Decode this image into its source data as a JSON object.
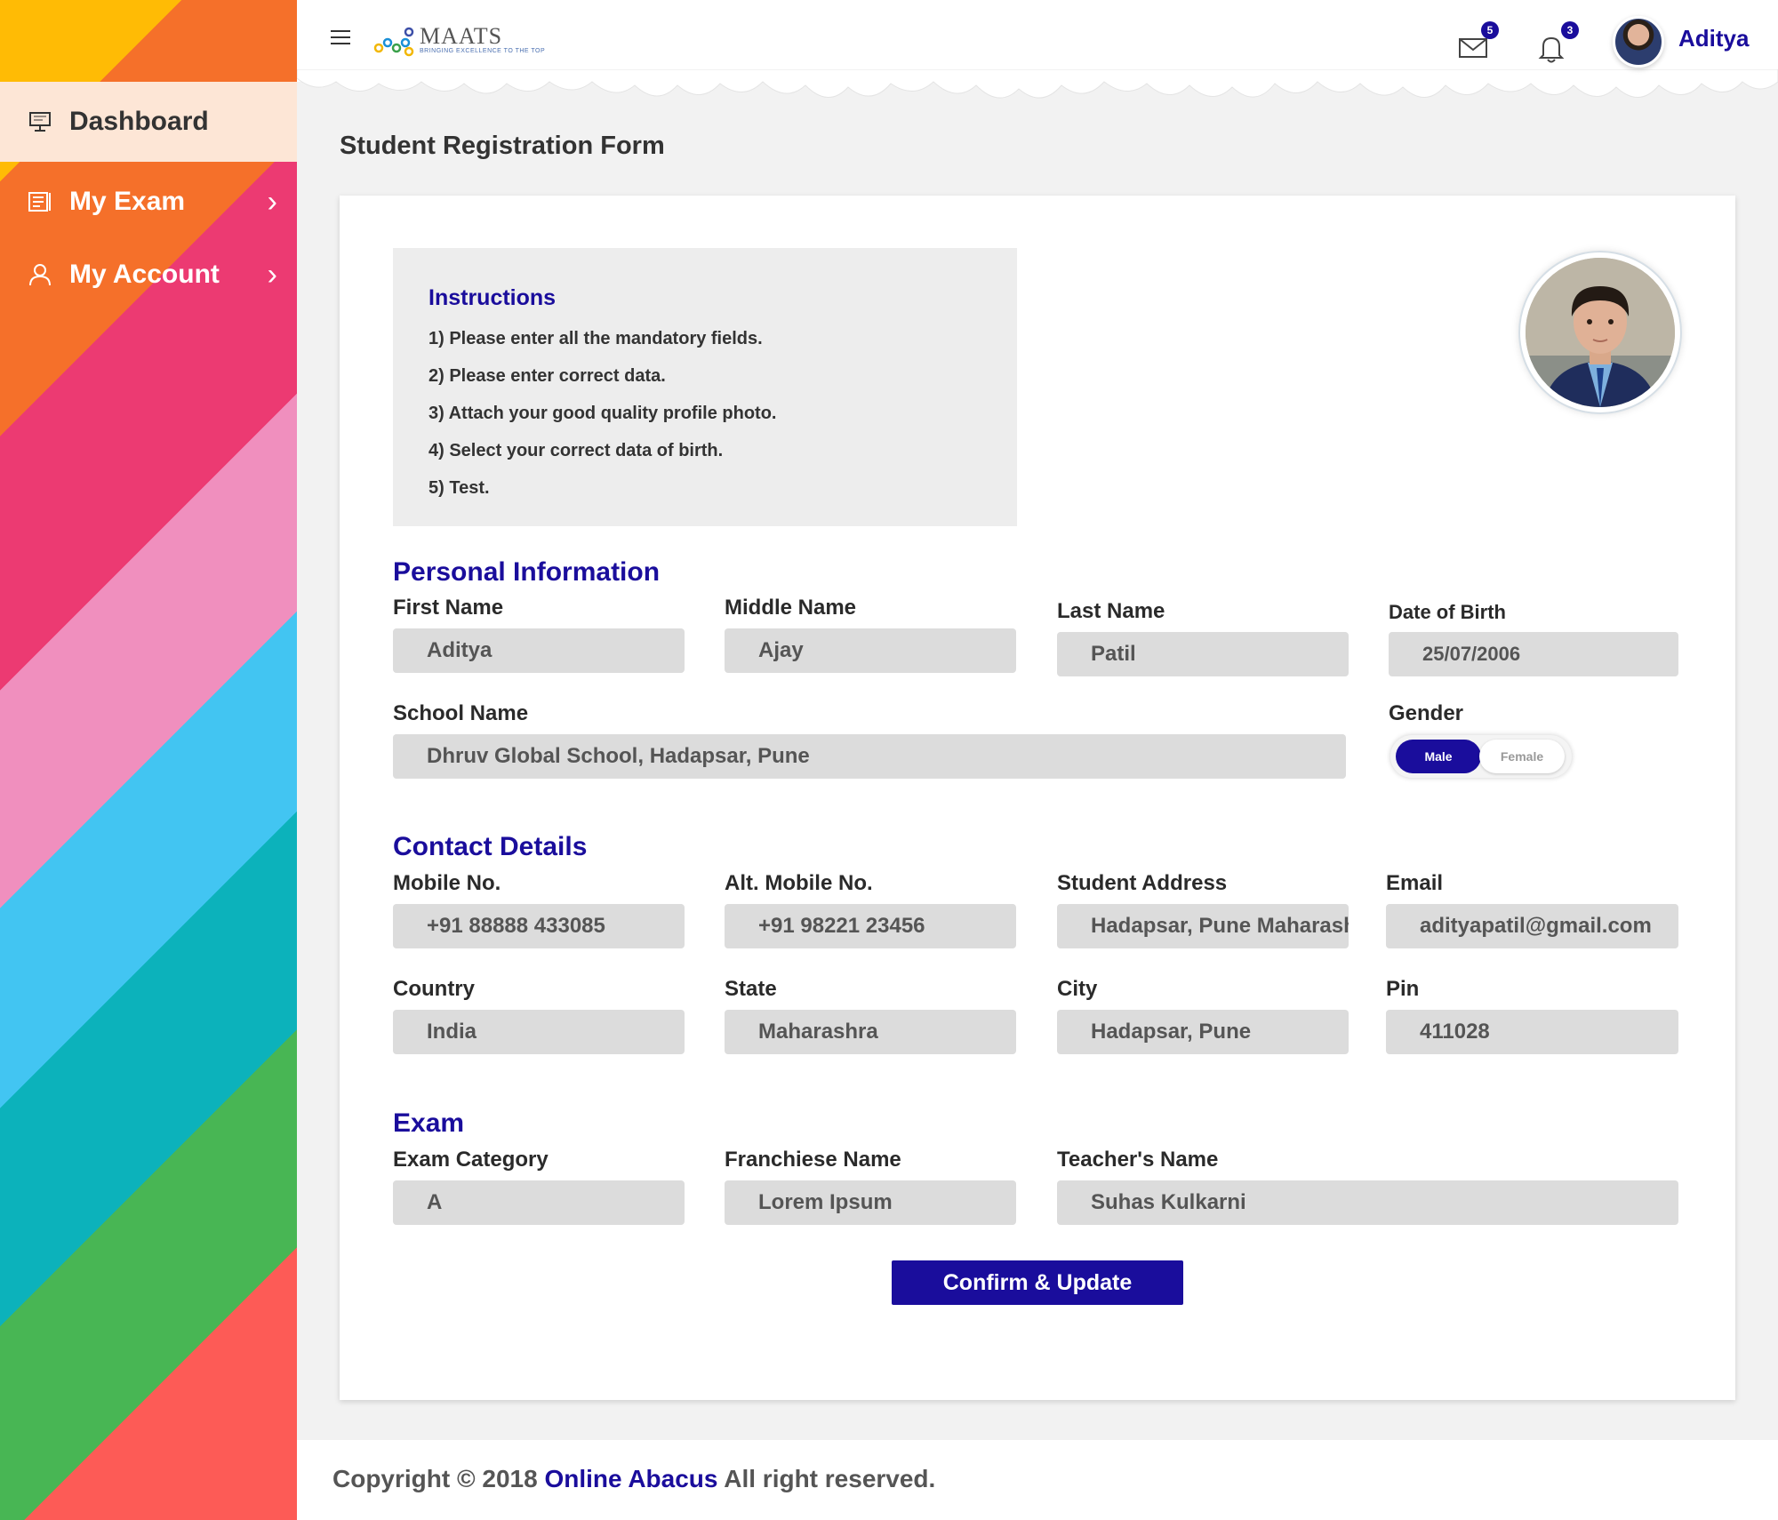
{
  "sidebar": {
    "items": [
      {
        "label": "Dashboard",
        "icon": "monitor-icon",
        "active": true
      },
      {
        "label": "My Exam",
        "icon": "exam-icon",
        "active": false
      },
      {
        "label": "My Account",
        "icon": "user-icon",
        "active": false
      }
    ]
  },
  "header": {
    "logo_name": "MAATS",
    "logo_tagline": "BRINGING EXCELLENCE TO THE TOP",
    "mail_count": "5",
    "notification_count": "3",
    "user_name": "Aditya"
  },
  "page_title": "Student Registration Form",
  "instructions": {
    "title": "Instructions",
    "items": [
      "1) Please enter all the mandatory fields.",
      "2) Please enter correct data.",
      "3) Attach your good quality profile photo.",
      "4) Select your correct data of birth.",
      "5) Test."
    ]
  },
  "personal": {
    "title": "Personal Information",
    "first_name_label": "First Name",
    "first_name": "Aditya",
    "middle_name_label": "Middle Name",
    "middle_name": "Ajay",
    "last_name_label": "Last Name",
    "last_name": "Patil",
    "dob_label": "Date of Birth",
    "dob": "25/07/2006",
    "school_label": "School Name",
    "school": "Dhruv Global School, Hadapsar, Pune",
    "gender_label": "Gender",
    "gender_male": "Male",
    "gender_female": "Female",
    "gender_selected": "Male"
  },
  "contact": {
    "title": "Contact Details",
    "mobile_label": "Mobile No.",
    "mobile": "+91 88888 433085",
    "alt_mobile_label": "Alt. Mobile No.",
    "alt_mobile": "+91 98221 23456",
    "address_label": "Student Address",
    "address": "Hadapsar, Pune Maharashtra",
    "email_label": "Email",
    "email": "adityapatil@gmail.com",
    "country_label": "Country",
    "country": "India",
    "state_label": "State",
    "state": "Maharashra",
    "city_label": "City",
    "city": "Hadapsar, Pune",
    "pin_label": "Pin",
    "pin": "411028"
  },
  "exam": {
    "title": "Exam",
    "category_label": "Exam Category",
    "category": "A",
    "franchise_label": "Franchiese Name",
    "franchise": "Lorem Ipsum",
    "teacher_label": "Teacher's Name",
    "teacher": "Suhas Kulkarni"
  },
  "submit_label": "Confirm & Update",
  "footer": {
    "prefix": "Copyright © 2018",
    "brand": "Online Abacus",
    "suffix": "All right reserved."
  },
  "colors": {
    "accent": "#1a0d9c",
    "field_bg": "#dcdcdc"
  }
}
